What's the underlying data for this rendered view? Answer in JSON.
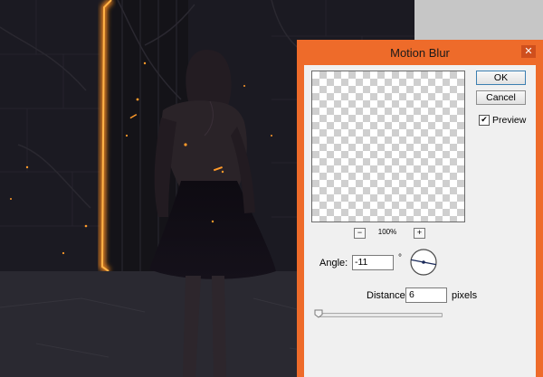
{
  "dialog": {
    "title": "Motion Blur",
    "close_icon": "close-icon",
    "ok_label": "OK",
    "cancel_label": "Cancel",
    "preview_label": "Preview",
    "preview_checked": true,
    "zoom_out_label": "−",
    "zoom_in_label": "+",
    "zoom_level": "100%",
    "angle_label": "Angle:",
    "angle_value": "-11",
    "angle_unit": "°",
    "distance_label": "Distance:",
    "distance_value": "6",
    "distance_unit": "pixels",
    "distance_slider_fraction": 0.0
  },
  "colors": {
    "dialog_frame": "#ee6b2a",
    "close_button": "#cf4f1d",
    "ok_button_border": "#3c7fb1",
    "glow": "#ff8c1a"
  },
  "checkmark_icon": "checkmark-icon"
}
